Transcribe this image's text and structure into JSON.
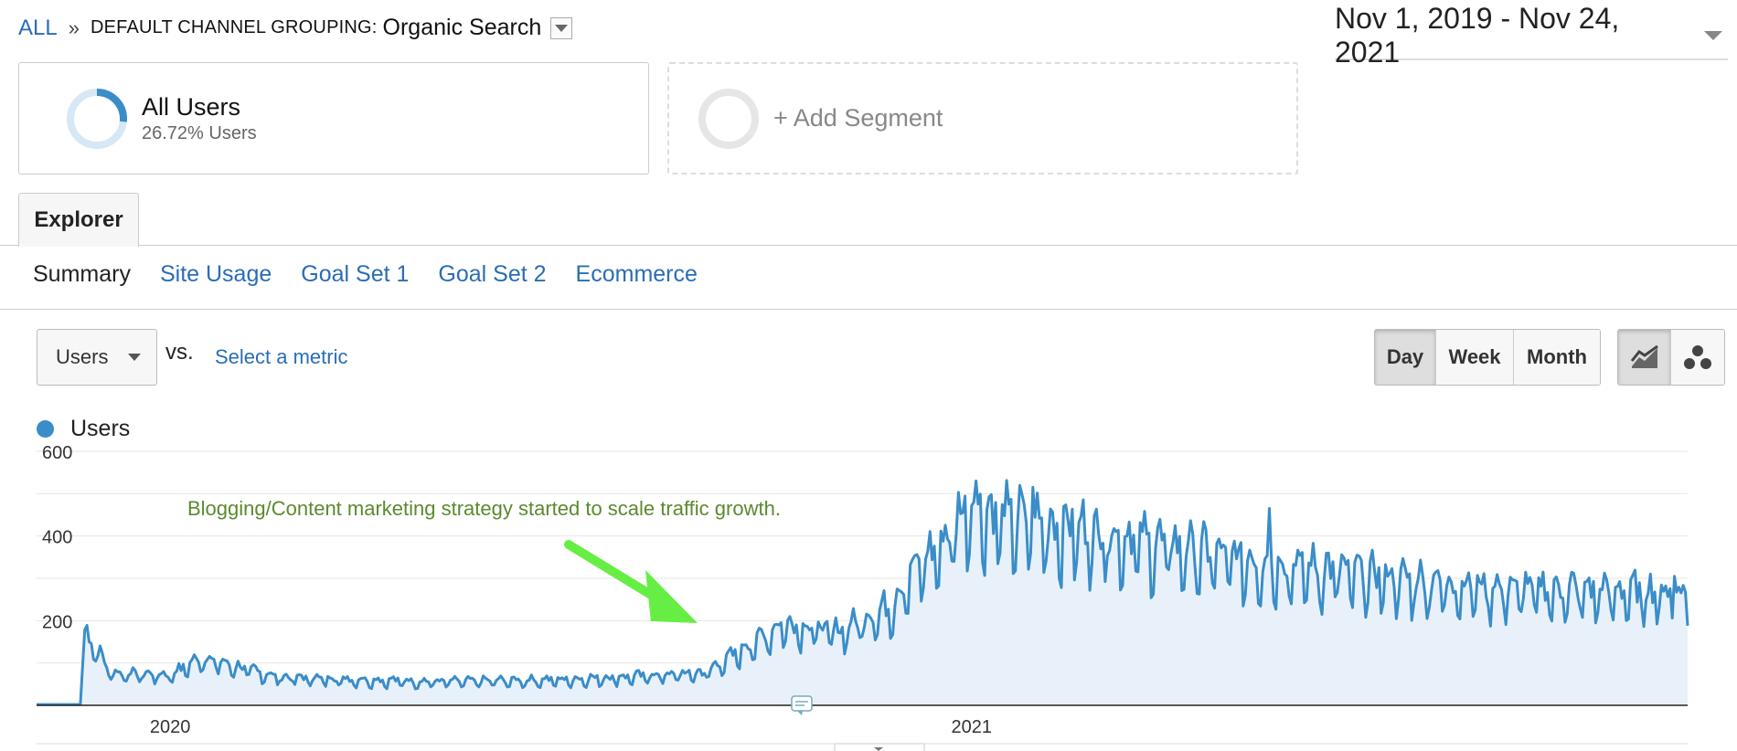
{
  "breadcrumb": {
    "root": "ALL",
    "separator": "»",
    "dimension": "DEFAULT CHANNEL GROUPING:",
    "value": "Organic Search"
  },
  "date_range": "Nov 1, 2019 - Nov 24, 2021",
  "segments": [
    {
      "name": "All Users",
      "detail": "26.72% Users",
      "share": 0.2672
    },
    {
      "name": "+ Add Segment"
    }
  ],
  "tabs": [
    {
      "label": "Explorer",
      "active": true
    }
  ],
  "subtabs": [
    {
      "label": "Summary",
      "active": true
    },
    {
      "label": "Site Usage"
    },
    {
      "label": "Goal Set 1"
    },
    {
      "label": "Goal Set 2"
    },
    {
      "label": "Ecommerce"
    }
  ],
  "metric_controls": {
    "primary_metric": "Users",
    "vs_label": "vs.",
    "select_metric": "Select a metric"
  },
  "granularity": [
    {
      "label": "Day",
      "active": true
    },
    {
      "label": "Week"
    },
    {
      "label": "Month"
    }
  ],
  "chart_type_buttons": [
    {
      "icon": "line-chart-icon",
      "active": true
    },
    {
      "icon": "motion-chart-icon"
    }
  ],
  "colors": {
    "series": "#3a8dc8",
    "fill": "#e8f1f9",
    "annotation_text": "#5b8a2f",
    "arrow": "#66ee44",
    "link": "#2a6db5"
  },
  "annotation": "Blogging/Content marketing strategy started to scale traffic growth.",
  "chart_data": {
    "type": "area",
    "title": "",
    "legend": [
      {
        "name": "Users",
        "color": "#3a8dc8"
      }
    ],
    "legend_position": "top-left",
    "xlabel": "",
    "ylabel": "",
    "ylim": [
      0,
      600
    ],
    "yticks": [
      200,
      400,
      600
    ],
    "x_tick_labels": [
      {
        "label": "2020",
        "date": "2020-01-01"
      },
      {
        "label": "2021",
        "date": "2021-01-01"
      }
    ],
    "x_range": [
      "2019-11-01",
      "2021-11-24"
    ],
    "grid": true,
    "series": [
      {
        "name": "Users",
        "note": "Daily values approximated from key points, interpolated with weekly seasonality",
        "keypoints": [
          {
            "date": "2019-11-01",
            "value": 2
          },
          {
            "date": "2019-11-21",
            "value": 2
          },
          {
            "date": "2019-11-23",
            "value": 175
          },
          {
            "date": "2019-12-05",
            "value": 75
          },
          {
            "date": "2020-01-01",
            "value": 70
          },
          {
            "date": "2020-01-15",
            "value": 110
          },
          {
            "date": "2020-02-20",
            "value": 65
          },
          {
            "date": "2020-05-01",
            "value": 55
          },
          {
            "date": "2020-07-01",
            "value": 60
          },
          {
            "date": "2020-09-01",
            "value": 75
          },
          {
            "date": "2020-09-25",
            "value": 150
          },
          {
            "date": "2020-10-07",
            "value": 190
          },
          {
            "date": "2020-11-01",
            "value": 170
          },
          {
            "date": "2020-11-25",
            "value": 230
          },
          {
            "date": "2020-12-05",
            "value": 310
          },
          {
            "date": "2020-12-20",
            "value": 380
          },
          {
            "date": "2021-01-01",
            "value": 480
          },
          {
            "date": "2021-01-10",
            "value": 440
          },
          {
            "date": "2021-03-01",
            "value": 400
          },
          {
            "date": "2021-05-01",
            "value": 340
          },
          {
            "date": "2021-07-01",
            "value": 300
          },
          {
            "date": "2021-09-01",
            "value": 270
          },
          {
            "date": "2021-11-24",
            "value": 260
          }
        ],
        "spikes": [
          {
            "date": "2019-11-23",
            "value": 178
          },
          {
            "date": "2021-01-03",
            "value": 530
          },
          {
            "date": "2021-01-29",
            "value": 515
          },
          {
            "date": "2021-05-17",
            "value": 465
          },
          {
            "date": "2021-11-18",
            "value": 305
          }
        ]
      }
    ]
  }
}
